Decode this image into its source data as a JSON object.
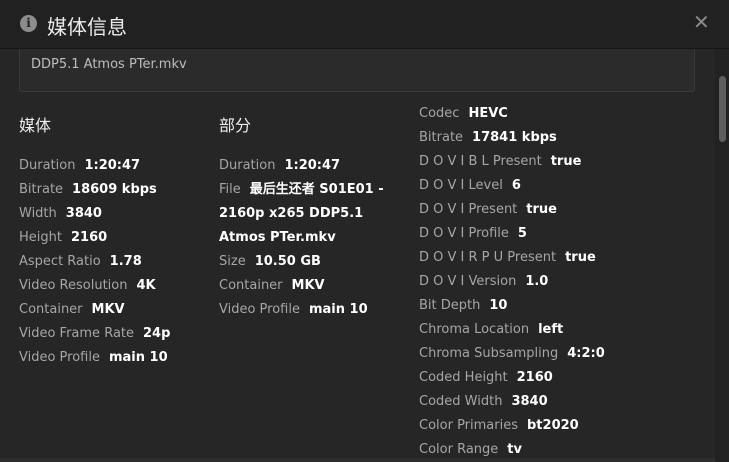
{
  "header": {
    "title": "媒体信息",
    "close_label": "✕"
  },
  "file_path": "DDP5.1 Atmos PTer.mkv",
  "video": {
    "heading": "媒体",
    "rows": [
      {
        "k": "Duration",
        "v": "1:20:47"
      },
      {
        "k": "Bitrate",
        "v": "18609 kbps"
      },
      {
        "k": "Width",
        "v": "3840"
      },
      {
        "k": "Height",
        "v": "2160"
      },
      {
        "k": "Aspect Ratio",
        "v": "1.78"
      },
      {
        "k": "Video Resolution",
        "v": "4K"
      },
      {
        "k": "Container",
        "v": "MKV"
      },
      {
        "k": "Video Frame Rate",
        "v": "24p"
      },
      {
        "k": "Video Profile",
        "v": "main 10"
      }
    ]
  },
  "part": {
    "heading": "部分",
    "rows": [
      {
        "k": "Duration",
        "v": "1:20:47"
      },
      {
        "k": "File",
        "v": "最后生还者 S01E01 - 2160p x265 DDP5.1 Atmos PTer.mkv"
      },
      {
        "k": "Size",
        "v": "10.50 GB"
      },
      {
        "k": "Container",
        "v": "MKV"
      },
      {
        "k": "Video Profile",
        "v": "main 10"
      }
    ]
  },
  "stream": {
    "rows": [
      {
        "k": "Codec",
        "v": "HEVC"
      },
      {
        "k": "Bitrate",
        "v": "17841 kbps"
      },
      {
        "k": "D O V I B L Present",
        "v": "true"
      },
      {
        "k": "D O V I Level",
        "v": "6"
      },
      {
        "k": "D O V I Present",
        "v": "true"
      },
      {
        "k": "D O V I Profile",
        "v": "5"
      },
      {
        "k": "D O V I R P U Present",
        "v": "true"
      },
      {
        "k": "D O V I Version",
        "v": "1.0"
      },
      {
        "k": "Bit Depth",
        "v": "10"
      },
      {
        "k": "Chroma Location",
        "v": "left"
      },
      {
        "k": "Chroma Subsampling",
        "v": "4:2:0"
      },
      {
        "k": "Coded Height",
        "v": "2160"
      },
      {
        "k": "Coded Width",
        "v": "3840"
      },
      {
        "k": "Color Primaries",
        "v": "bt2020"
      },
      {
        "k": "Color Range",
        "v": "tv"
      }
    ]
  },
  "icons": {
    "header": "info-icon",
    "close": "close-icon"
  }
}
